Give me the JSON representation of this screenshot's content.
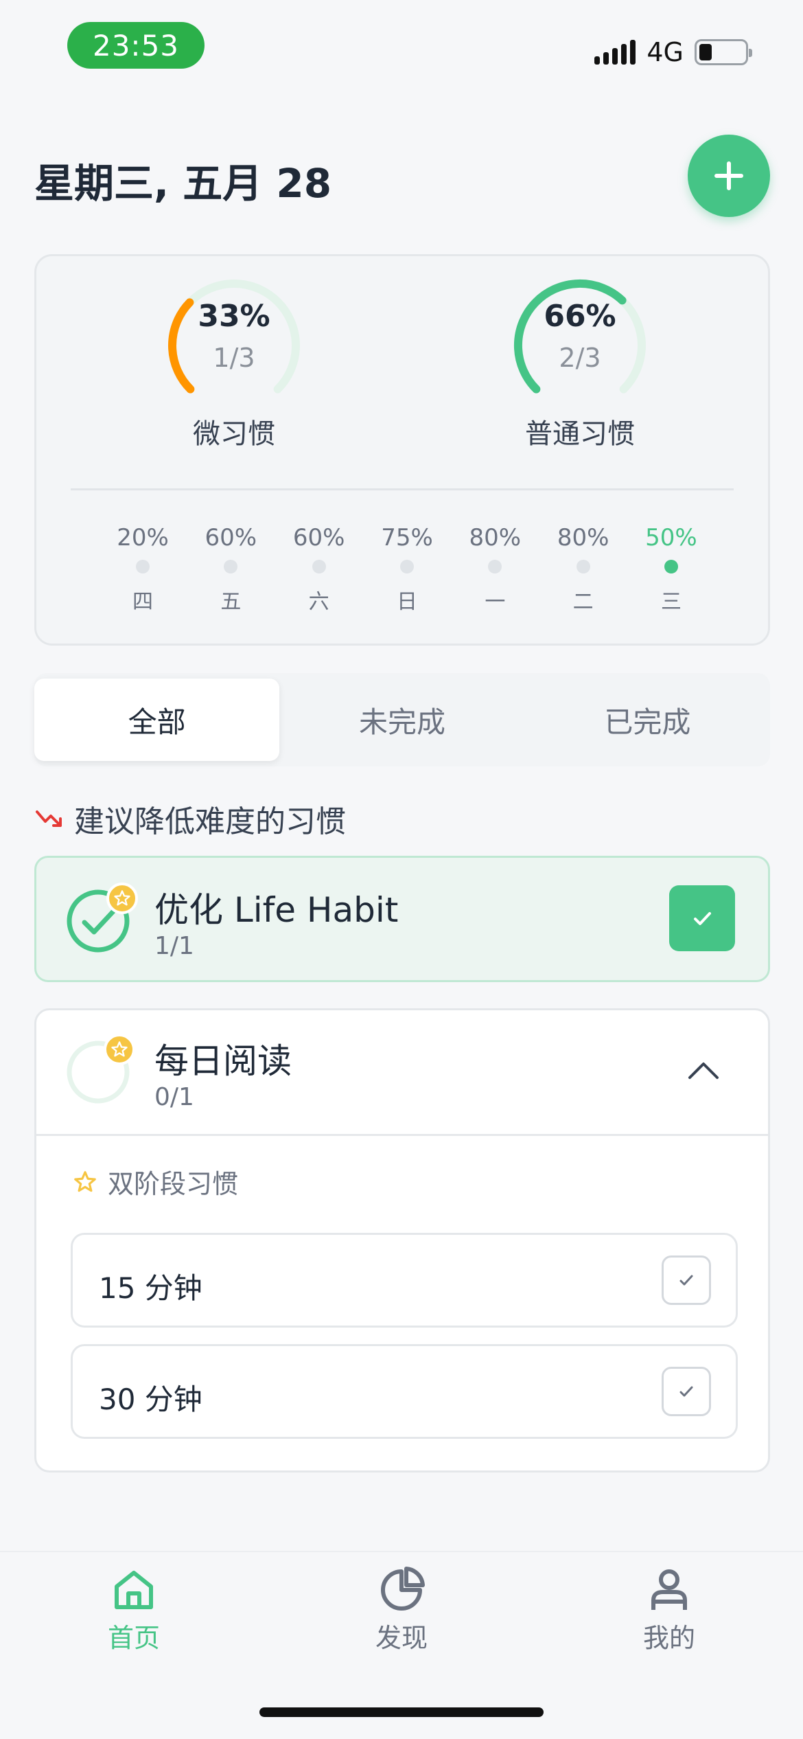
{
  "status_bar": {
    "time": "23:53",
    "network": "4G"
  },
  "header": {
    "date": "星期三, 五月 28"
  },
  "stats": {
    "rings": [
      {
        "label": "微习惯",
        "percent": "33%",
        "fraction": "1/3",
        "progress": 0.33,
        "color": "#ff9500"
      },
      {
        "label": "普通习惯",
        "percent": "66%",
        "fraction": "2/3",
        "progress": 0.66,
        "color": "#45c486"
      }
    ],
    "week": [
      {
        "pct": "20%",
        "day": "四",
        "active": false
      },
      {
        "pct": "60%",
        "day": "五",
        "active": false
      },
      {
        "pct": "60%",
        "day": "六",
        "active": false
      },
      {
        "pct": "75%",
        "day": "日",
        "active": false
      },
      {
        "pct": "80%",
        "day": "一",
        "active": false
      },
      {
        "pct": "80%",
        "day": "二",
        "active": false
      },
      {
        "pct": "50%",
        "day": "三",
        "active": true
      }
    ]
  },
  "tabs": [
    {
      "label": "全部",
      "active": true
    },
    {
      "label": "未完成",
      "active": false
    },
    {
      "label": "已完成",
      "active": false
    }
  ],
  "section": {
    "title": "建议降低难度的习惯"
  },
  "habits": [
    {
      "name": "优化 Life Habit",
      "count": "1/1",
      "completed": true,
      "progress": 1.0
    },
    {
      "name": "每日阅读",
      "count": "0/1",
      "completed": false,
      "progress": 0.0,
      "expanded_title": "双阶段习惯",
      "stages": [
        {
          "label": "15 分钟"
        },
        {
          "label": "30 分钟"
        }
      ]
    }
  ],
  "nav": [
    {
      "label": "首页",
      "icon": "home-icon",
      "active": true
    },
    {
      "label": "发现",
      "icon": "pie-chart-icon",
      "active": false
    },
    {
      "label": "我的",
      "icon": "user-icon",
      "active": false
    }
  ],
  "colors": {
    "accent": "#45c486",
    "orange": "#ff9500",
    "star": "#f6c543",
    "trend_down": "#e53935"
  }
}
